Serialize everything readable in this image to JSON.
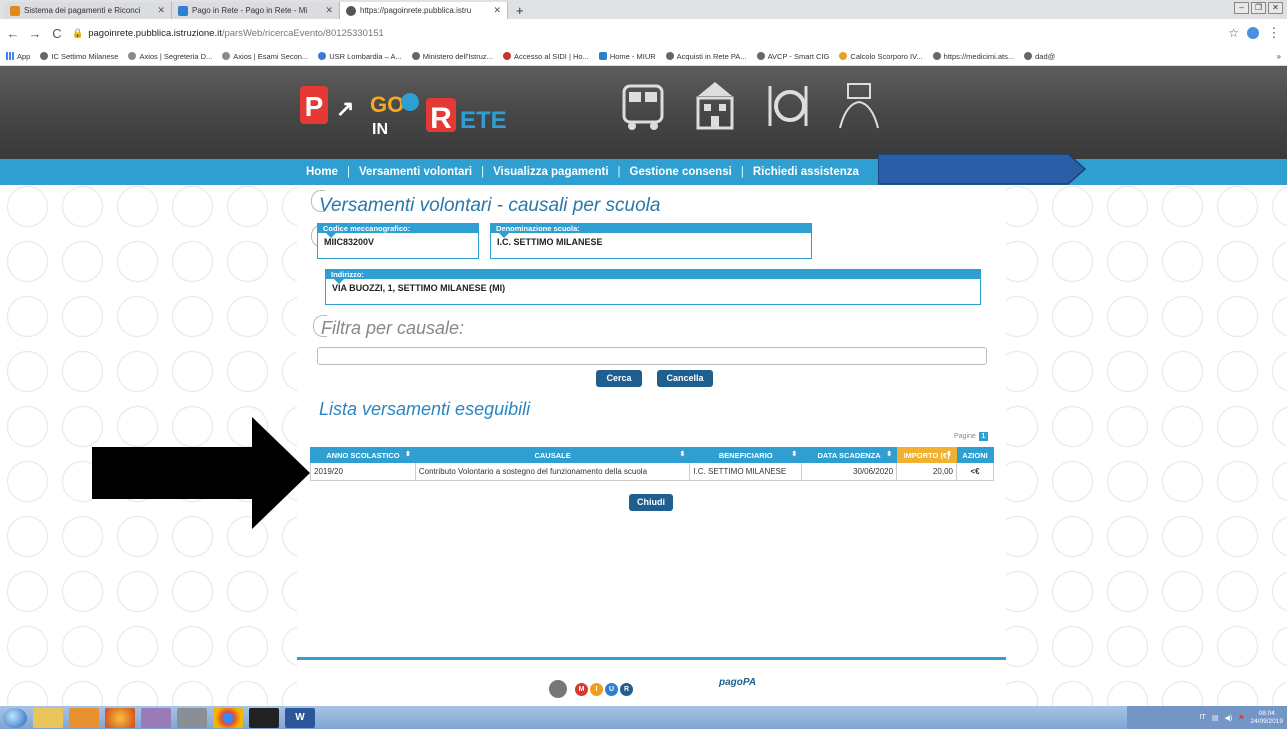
{
  "browser": {
    "tabs": [
      {
        "label": "Sistema dei pagamenti e Riconci",
        "icon_color": "#e08a1e",
        "active": false
      },
      {
        "label": "Pago in Rete - Pago in Rete - Mi",
        "icon_color": "#2f7fd1",
        "active": false
      },
      {
        "label": "https://pagoinrete.pubblica.istru",
        "icon_color": "#555555",
        "active": true
      }
    ],
    "new_tab_label": "+",
    "url_domain": "pagoinrete.pubblica.istruzione.it",
    "url_path": "/parsWeb/ricercaEvento/80125330151",
    "bookmarks": [
      "App",
      "IC Settimo Milanese",
      "Axios | Segreteria D...",
      "Axios | Esami Secon...",
      "USR Lombardia – A...",
      "Ministero dell'Istruz...",
      "Accesso al SIDI | Ho...",
      "Home - MIUR",
      "Acquisti in Rete PA...",
      "AVCP - Smart CIG",
      "Calcolo Scorporo IV...",
      "https://medicimi.ats...",
      "dad@"
    ],
    "bookmarks_more": "»"
  },
  "site": {
    "nav": [
      "Home",
      "Versamenti volontari",
      "Visualizza pagamenti",
      "Gestione consensi",
      "Richiedi assistenza"
    ],
    "nav_separator": "|",
    "page_title": "Versamenti volontari - causali per scuola",
    "codice_label": "Codice meccanografico:",
    "codice_value": "MIIC83200V",
    "denominazione_label": "Denominazione scuola:",
    "denominazione_value": "I.C. SETTIMO MILANESE",
    "indirizzo_label": "Indirizzo:",
    "indirizzo_value": "VIA BUOZZI, 1, SETTIMO MILANESE (MI)",
    "filter_title": "Filtra per causale:",
    "filter_value": "",
    "search_button": "Cerca",
    "cancel_button": "Cancella",
    "list_title": "Lista versamenti eseguibili",
    "pages_label": "Pagine",
    "current_page": "1",
    "table": {
      "columns": [
        "ANNO SCOLASTICO",
        "CAUSALE",
        "BENEFICIARIO",
        "DATA SCADENZA",
        "IMPORTO (€)",
        "AZIONI"
      ],
      "rows": [
        [
          "2019/20",
          "Contributo Volontario a sostegno del funzionamento della scuola",
          "I.C. SETTIMO MILANESE",
          "30/06/2020",
          "20,00",
          "<€"
        ]
      ]
    },
    "close_button": "Chiudi",
    "footer_miur_letters": [
      "M",
      "I",
      "U",
      "R"
    ],
    "footer_pagopa": "pagoPA",
    "logo_text_top": "PAGO",
    "logo_text_in": "IN",
    "logo_text_rete": "RETE"
  },
  "taskbar": {
    "apps": [
      "explorer",
      "outlook",
      "firefox",
      "people",
      "lock",
      "chrome",
      "cmd",
      "word"
    ],
    "word_label": "W",
    "tray_lang": "IT",
    "clock_time": "08:04",
    "clock_date": "24/09/2019"
  },
  "colors": {
    "accent": "#2f9fd1",
    "dark_button": "#1f5f8f",
    "importo_header": "#f0b030",
    "redaction": "#2a5fa8"
  }
}
